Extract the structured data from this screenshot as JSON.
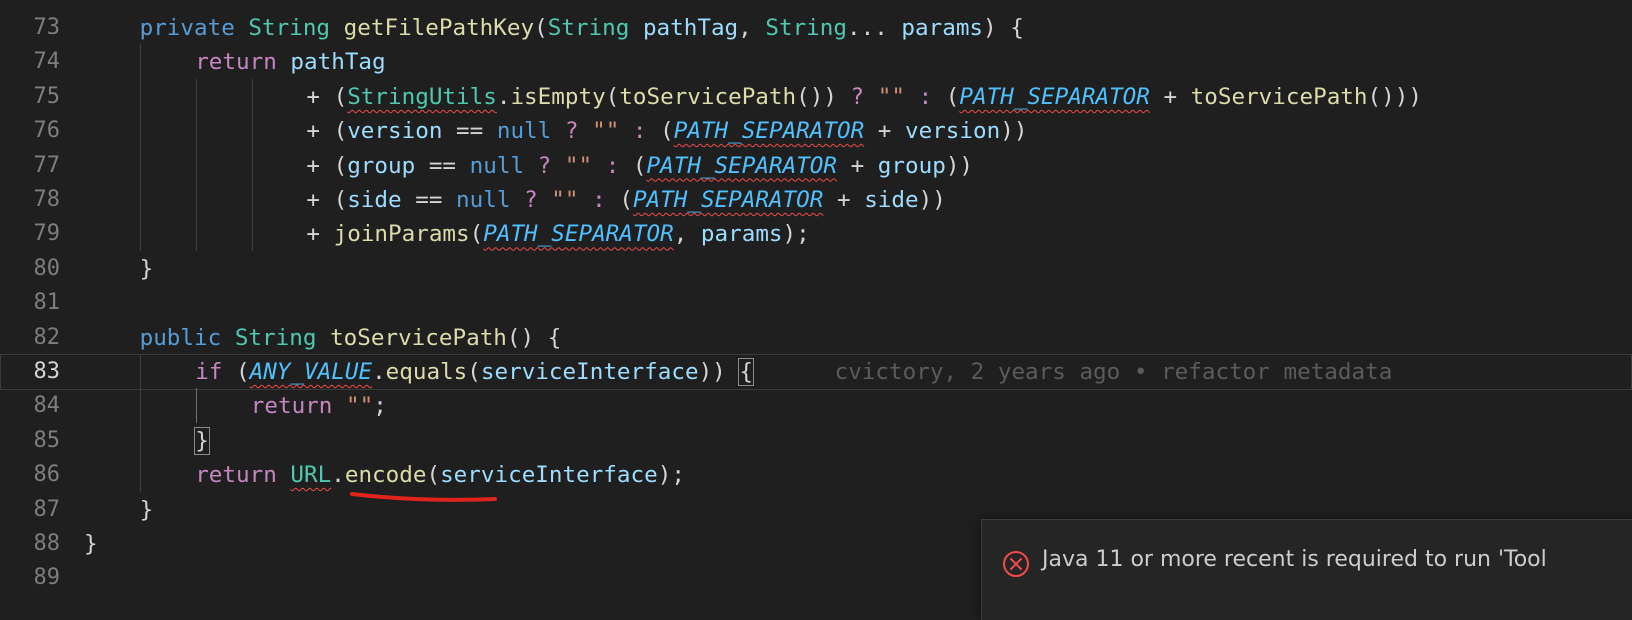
{
  "editor": {
    "current_line": "83",
    "lines": [
      {
        "num": "73",
        "parts": [
          [
            "kw",
            "private"
          ],
          [
            "op",
            " "
          ],
          [
            "ty",
            "String"
          ],
          [
            "op",
            " "
          ],
          [
            "fn",
            "getFilePathKey"
          ],
          [
            "op",
            "("
          ],
          [
            "ty",
            "String"
          ],
          [
            "op",
            " "
          ],
          [
            "pr",
            "pathTag"
          ],
          [
            "op",
            ", "
          ],
          [
            "ty",
            "String"
          ],
          [
            "op",
            "... "
          ],
          [
            "pr",
            "params"
          ],
          [
            "op",
            ") {"
          ]
        ]
      },
      {
        "num": "74",
        "parts": [
          [
            "kw2",
            "return"
          ],
          [
            "op",
            " "
          ],
          [
            "pr",
            "pathTag"
          ]
        ]
      },
      {
        "num": "75",
        "parts": [
          [
            "op",
            "+ ("
          ],
          [
            "ty squig",
            "StringUtils"
          ],
          [
            "op",
            "."
          ],
          [
            "fn",
            "isEmpty"
          ],
          [
            "op",
            "("
          ],
          [
            "fn",
            "toServicePath"
          ],
          [
            "op",
            "()) "
          ],
          [
            "kw2",
            "?"
          ],
          [
            "op",
            " "
          ],
          [
            "st",
            "\"\""
          ],
          [
            "op",
            " "
          ],
          [
            "kw2",
            ":"
          ],
          [
            "op",
            " ("
          ],
          [
            "cn squig",
            "PATH_SEPARATOR"
          ],
          [
            "op",
            " + "
          ],
          [
            "fn",
            "toServicePath"
          ],
          [
            "op",
            "()))"
          ]
        ]
      },
      {
        "num": "76",
        "parts": [
          [
            "op",
            "+ ("
          ],
          [
            "pr",
            "version"
          ],
          [
            "op",
            " == "
          ],
          [
            "kw",
            "null"
          ],
          [
            "op",
            " "
          ],
          [
            "kw2",
            "?"
          ],
          [
            "op",
            " "
          ],
          [
            "st",
            "\"\""
          ],
          [
            "op",
            " "
          ],
          [
            "kw2",
            ":"
          ],
          [
            "op",
            " ("
          ],
          [
            "cn squig",
            "PATH_SEPARATOR"
          ],
          [
            "op",
            " + "
          ],
          [
            "pr",
            "version"
          ],
          [
            "op",
            "))"
          ]
        ]
      },
      {
        "num": "77",
        "parts": [
          [
            "op",
            "+ ("
          ],
          [
            "pr",
            "group"
          ],
          [
            "op",
            " == "
          ],
          [
            "kw",
            "null"
          ],
          [
            "op",
            " "
          ],
          [
            "kw2",
            "?"
          ],
          [
            "op",
            " "
          ],
          [
            "st",
            "\"\""
          ],
          [
            "op",
            " "
          ],
          [
            "kw2",
            ":"
          ],
          [
            "op",
            " ("
          ],
          [
            "cn squig",
            "PATH_SEPARATOR"
          ],
          [
            "op",
            " + "
          ],
          [
            "pr",
            "group"
          ],
          [
            "op",
            "))"
          ]
        ]
      },
      {
        "num": "78",
        "parts": [
          [
            "op",
            "+ ("
          ],
          [
            "pr",
            "side"
          ],
          [
            "op",
            " == "
          ],
          [
            "kw",
            "null"
          ],
          [
            "op",
            " "
          ],
          [
            "kw2",
            "?"
          ],
          [
            "op",
            " "
          ],
          [
            "st",
            "\"\""
          ],
          [
            "op",
            " "
          ],
          [
            "kw2",
            ":"
          ],
          [
            "op",
            " ("
          ],
          [
            "cn squig",
            "PATH_SEPARATOR"
          ],
          [
            "op",
            " + "
          ],
          [
            "pr",
            "side"
          ],
          [
            "op",
            "))"
          ]
        ]
      },
      {
        "num": "79",
        "parts": [
          [
            "op",
            "+ "
          ],
          [
            "fn",
            "joinParams"
          ],
          [
            "op",
            "("
          ],
          [
            "cn squig",
            "PATH_SEPARATOR"
          ],
          [
            "op",
            ", "
          ],
          [
            "pr",
            "params"
          ],
          [
            "op",
            ");"
          ]
        ]
      },
      {
        "num": "80",
        "parts": [
          [
            "op",
            "}"
          ]
        ]
      },
      {
        "num": "81",
        "parts": []
      },
      {
        "num": "82",
        "parts": [
          [
            "kw",
            "public"
          ],
          [
            "op",
            " "
          ],
          [
            "ty",
            "String"
          ],
          [
            "op",
            " "
          ],
          [
            "fn",
            "toServicePath"
          ],
          [
            "op",
            "() {"
          ]
        ]
      },
      {
        "num": "83",
        "parts": [
          [
            "kw2",
            "if"
          ],
          [
            "op",
            " ("
          ],
          [
            "cn squig",
            "ANY_VALUE"
          ],
          [
            "op",
            "."
          ],
          [
            "fn",
            "equals"
          ],
          [
            "op",
            "("
          ],
          [
            "pr",
            "serviceInterface"
          ],
          [
            "op",
            ")) "
          ],
          [
            "op bracket-box",
            "{"
          ],
          [
            "op",
            "      "
          ],
          [
            "blame",
            "cvictory, 2 years ago • refactor metadata"
          ]
        ]
      },
      {
        "num": "84",
        "parts": [
          [
            "kw2",
            "return"
          ],
          [
            "op",
            " "
          ],
          [
            "st",
            "\"\""
          ],
          [
            "op",
            ";"
          ]
        ]
      },
      {
        "num": "85",
        "parts": [
          [
            "op bracket-box",
            "}"
          ]
        ]
      },
      {
        "num": "86",
        "parts": [
          [
            "kw2",
            "return"
          ],
          [
            "op",
            " "
          ],
          [
            "ty squig",
            "URL"
          ],
          [
            "op",
            "."
          ],
          [
            "fn",
            "encode"
          ],
          [
            "op",
            "("
          ],
          [
            "pr",
            "serviceInterface"
          ],
          [
            "op",
            ");"
          ]
        ]
      },
      {
        "num": "87",
        "parts": [
          [
            "op",
            "}"
          ]
        ]
      },
      {
        "num": "88",
        "parts": [
          [
            "op",
            "}"
          ]
        ]
      },
      {
        "num": "89",
        "parts": []
      }
    ]
  },
  "toast": {
    "message": "Java 11 or more recent is required to run 'Tool",
    "icon": "error-circle-icon",
    "icon_color": "#f14c4c"
  }
}
